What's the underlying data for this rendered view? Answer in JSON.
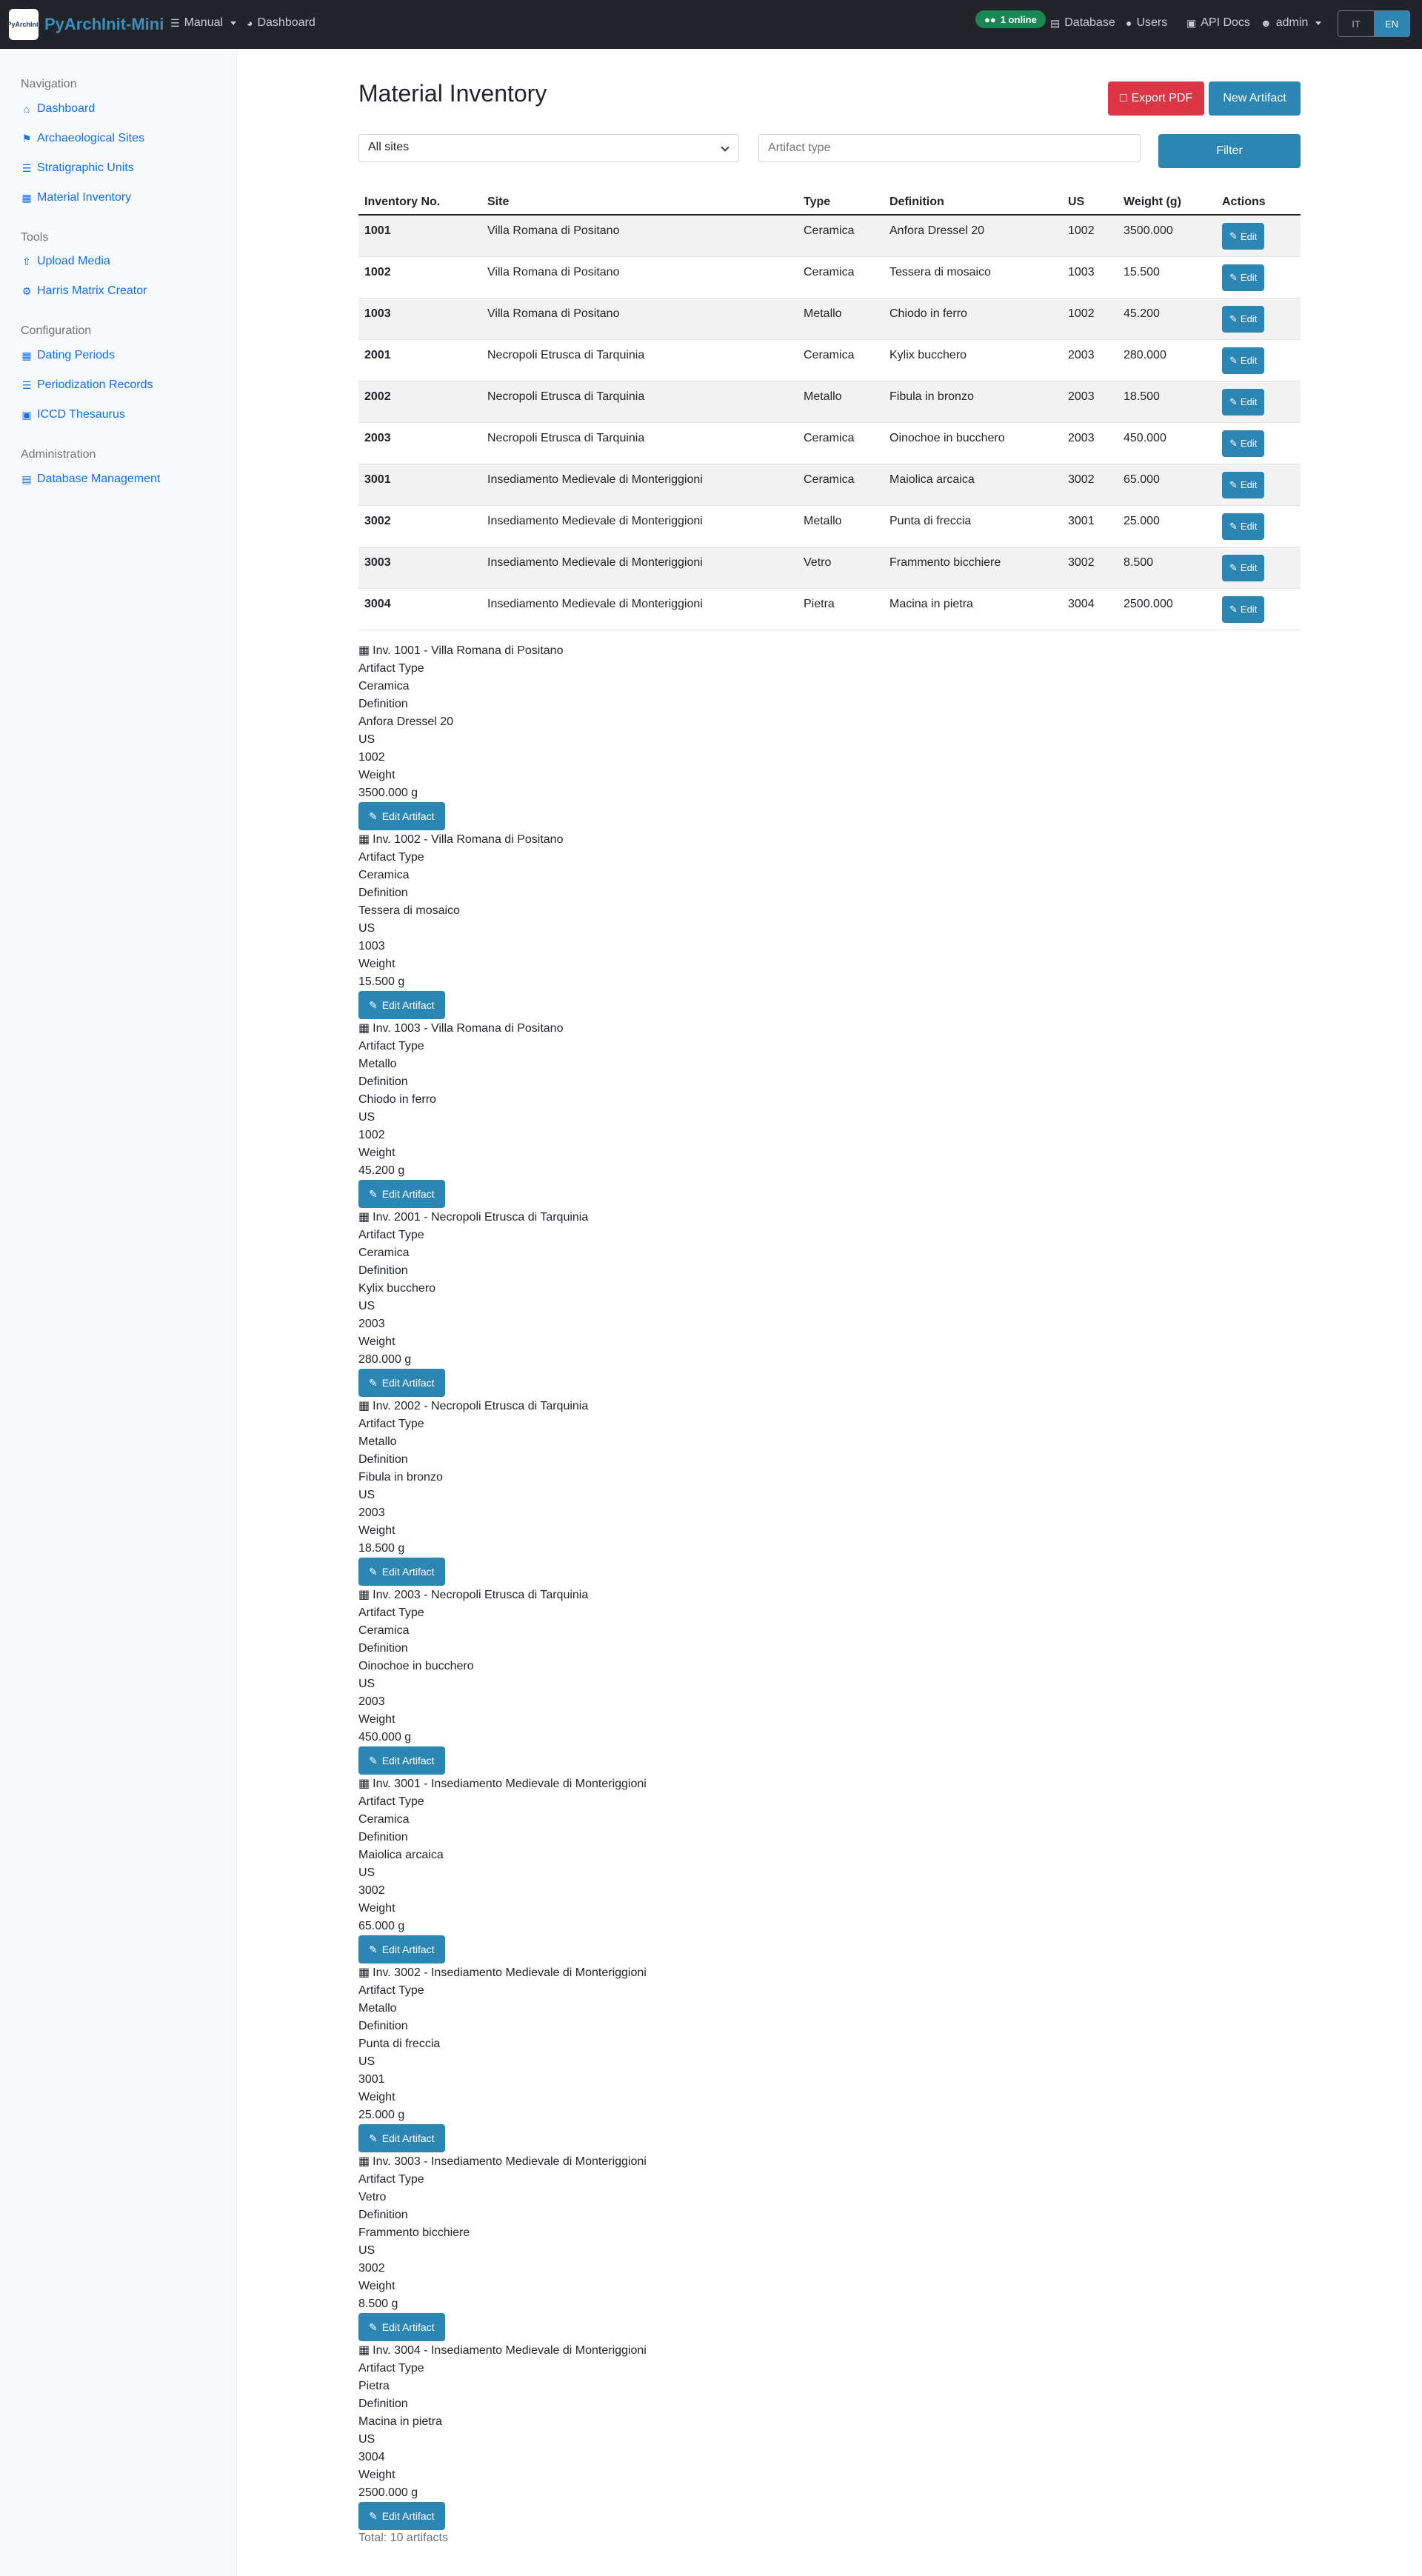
{
  "navbar": {
    "logo_text": "PyArchInit",
    "brand": "PyArchInit-Mini",
    "manual": "Manual",
    "dashboard": "Dashboard",
    "online": "1 online",
    "database": "Database",
    "users": "Users",
    "api_docs": "API Docs",
    "user": "admin",
    "lang_it": "IT",
    "lang_en": "EN"
  },
  "sidebar": {
    "nav_heading": "Navigation",
    "nav": [
      "Dashboard",
      "Archaeological Sites",
      "Stratigraphic Units",
      "Material Inventory"
    ],
    "tools_heading": "Tools",
    "tools": [
      "Upload Media",
      "Harris Matrix Creator"
    ],
    "config_heading": "Configuration",
    "config": [
      "Dating Periods",
      "Periodization Records",
      "ICCD Thesaurus"
    ],
    "admin_heading": "Administration",
    "admin": [
      "Database Management"
    ]
  },
  "main": {
    "title": "Material Inventory",
    "export_pdf": "Export PDF",
    "new_artifact": "New Artifact",
    "site_select": "All sites",
    "type_placeholder": "Artifact type",
    "filter": "Filter",
    "total": "Total: 10 artifacts"
  },
  "table": {
    "headers": [
      "Inventory No.",
      "Site",
      "Type",
      "Definition",
      "US",
      "Weight (g)",
      "Actions"
    ],
    "edit_label": "Edit",
    "rows": [
      {
        "inv": "1001",
        "site": "Villa Romana di Positano",
        "type": "Ceramica",
        "definition": "Anfora Dressel 20",
        "us": "1002",
        "weight": "3500.000"
      },
      {
        "inv": "1002",
        "site": "Villa Romana di Positano",
        "type": "Ceramica",
        "definition": "Tessera di mosaico",
        "us": "1003",
        "weight": "15.500"
      },
      {
        "inv": "1003",
        "site": "Villa Romana di Positano",
        "type": "Metallo",
        "definition": "Chiodo in ferro",
        "us": "1002",
        "weight": "45.200"
      },
      {
        "inv": "2001",
        "site": "Necropoli Etrusca di Tarquinia",
        "type": "Ceramica",
        "definition": "Kylix bucchero",
        "us": "2003",
        "weight": "280.000"
      },
      {
        "inv": "2002",
        "site": "Necropoli Etrusca di Tarquinia",
        "type": "Metallo",
        "definition": "Fibula in bronzo",
        "us": "2003",
        "weight": "18.500"
      },
      {
        "inv": "2003",
        "site": "Necropoli Etrusca di Tarquinia",
        "type": "Ceramica",
        "definition": "Oinochoe in bucchero",
        "us": "2003",
        "weight": "450.000"
      },
      {
        "inv": "3001",
        "site": "Insediamento Medievale di Monteriggioni",
        "type": "Ceramica",
        "definition": "Maiolica arcaica",
        "us": "3002",
        "weight": "65.000"
      },
      {
        "inv": "3002",
        "site": "Insediamento Medievale di Monteriggioni",
        "type": "Metallo",
        "definition": "Punta di freccia",
        "us": "3001",
        "weight": "25.000"
      },
      {
        "inv": "3003",
        "site": "Insediamento Medievale di Monteriggioni",
        "type": "Vetro",
        "definition": "Frammento bicchiere",
        "us": "3002",
        "weight": "8.500"
      },
      {
        "inv": "3004",
        "site": "Insediamento Medievale di Monteriggioni",
        "type": "Pietra",
        "definition": "Macina in pietra",
        "us": "3004",
        "weight": "2500.000"
      }
    ]
  },
  "cards": {
    "label_type": "Artifact Type",
    "label_definition": "Definition",
    "label_us": "US",
    "label_weight": "Weight",
    "edit_label": "Edit Artifact",
    "items": [
      {
        "title": "Inv. 1001 - Villa Romana di Positano",
        "type": "Ceramica",
        "definition": "Anfora Dressel 20",
        "us": "1002",
        "weight": "3500.000 g"
      },
      {
        "title": "Inv. 1002 - Villa Romana di Positano",
        "type": "Ceramica",
        "definition": "Tessera di mosaico",
        "us": "1003",
        "weight": "15.500 g"
      },
      {
        "title": "Inv. 1003 - Villa Romana di Positano",
        "type": "Metallo",
        "definition": "Chiodo in ferro",
        "us": "1002",
        "weight": "45.200 g"
      },
      {
        "title": "Inv. 2001 - Necropoli Etrusca di Tarquinia",
        "type": "Ceramica",
        "definition": "Kylix bucchero",
        "us": "2003",
        "weight": "280.000 g"
      },
      {
        "title": "Inv. 2002 - Necropoli Etrusca di Tarquinia",
        "type": "Metallo",
        "definition": "Fibula in bronzo",
        "us": "2003",
        "weight": "18.500 g"
      },
      {
        "title": "Inv. 2003 - Necropoli Etrusca di Tarquinia",
        "type": "Ceramica",
        "definition": "Oinochoe in bucchero",
        "us": "2003",
        "weight": "450.000 g"
      },
      {
        "title": "Inv. 3001 - Insediamento Medievale di Monteriggioni",
        "type": "Ceramica",
        "definition": "Maiolica arcaica",
        "us": "3002",
        "weight": "65.000 g"
      },
      {
        "title": "Inv. 3002 - Insediamento Medievale di Monteriggioni",
        "type": "Metallo",
        "definition": "Punta di freccia",
        "us": "3001",
        "weight": "25.000 g"
      },
      {
        "title": "Inv. 3003 - Insediamento Medievale di Monteriggioni",
        "type": "Vetro",
        "definition": "Frammento bicchiere",
        "us": "3002",
        "weight": "8.500 g"
      },
      {
        "title": "Inv. 3004 - Insediamento Medievale di Monteriggioni",
        "type": "Pietra",
        "definition": "Macina in pietra",
        "us": "3004",
        "weight": "2500.000 g"
      }
    ]
  }
}
